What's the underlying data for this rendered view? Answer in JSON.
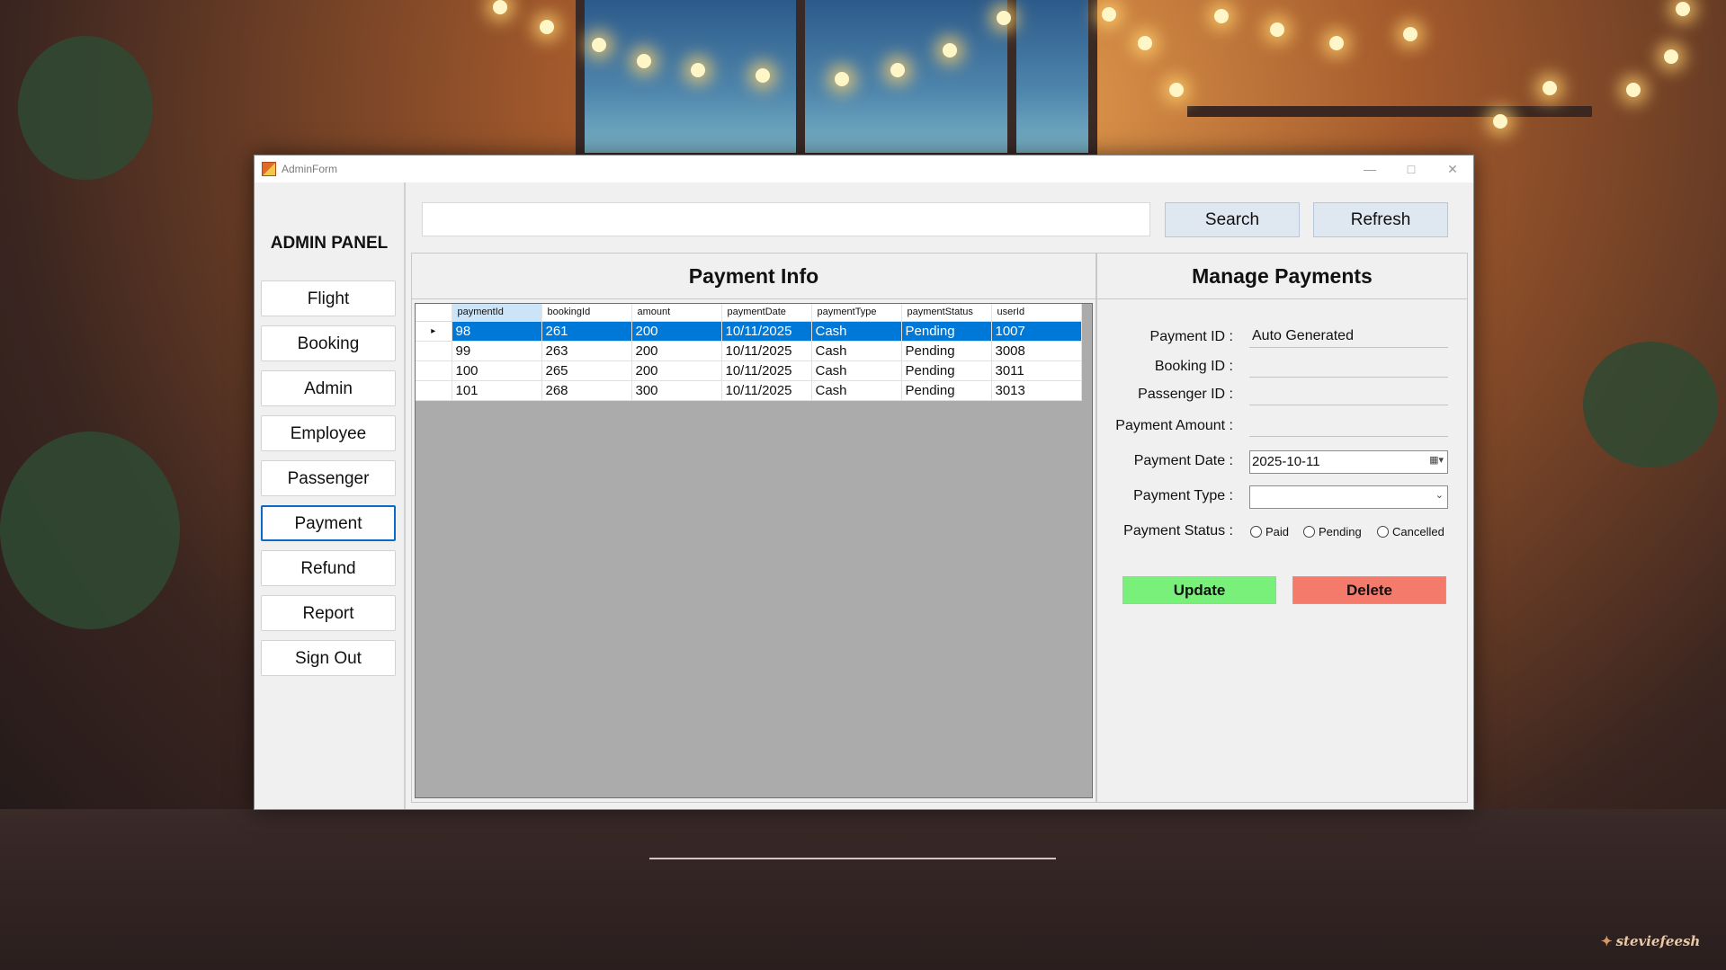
{
  "colors": {
    "selection": "#0078d7",
    "update": "#79f07a",
    "delete": "#f47a6c",
    "active_border": "#0b6bc4",
    "button_light": "#dfe7f1"
  },
  "window": {
    "title": "AdminForm",
    "icon": "app-icon"
  },
  "sidebar": {
    "heading": "ADMIN PANEL",
    "items": [
      {
        "label": "Flight"
      },
      {
        "label": "Booking"
      },
      {
        "label": "Admin"
      },
      {
        "label": "Employee"
      },
      {
        "label": "Passenger"
      },
      {
        "label": "Payment",
        "active": true
      },
      {
        "label": "Refund"
      },
      {
        "label": "Report"
      },
      {
        "label": "Sign Out"
      }
    ]
  },
  "search": {
    "value": "",
    "search_label": "Search",
    "refresh_label": "Refresh"
  },
  "payment_info": {
    "title": "Payment Info",
    "columns": [
      "paymentId",
      "bookingId",
      "amount",
      "paymentDate",
      "paymentType",
      "paymentStatus",
      "userId"
    ],
    "rows": [
      [
        "98",
        "261",
        "200",
        "10/11/2025",
        "Cash",
        "Pending",
        "1007"
      ],
      [
        "99",
        "263",
        "200",
        "10/11/2025",
        "Cash",
        "Pending",
        "3008"
      ],
      [
        "100",
        "265",
        "200",
        "10/11/2025",
        "Cash",
        "Pending",
        "3011"
      ],
      [
        "101",
        "268",
        "300",
        "10/11/2025",
        "Cash",
        "Pending",
        "3013"
      ]
    ],
    "selected_row": 0
  },
  "manage": {
    "title": "Manage Payments",
    "payment_id_label": "Payment ID :",
    "payment_id_value": "Auto Generated",
    "booking_id_label": "Booking ID :",
    "booking_id_value": "",
    "passenger_id_label": "Passenger ID :",
    "passenger_id_value": "",
    "amount_label": "Payment Amount :",
    "amount_value": "",
    "date_label": "Payment Date :",
    "date_value": "2025-10-11",
    "type_label": "Payment Type :",
    "type_value": "",
    "status_label": "Payment Status :",
    "status_options": [
      "Paid",
      "Pending",
      "Cancelled"
    ],
    "update_label": "Update",
    "delete_label": "Delete"
  },
  "wallpaper": {
    "credit": "steviefeesh"
  }
}
